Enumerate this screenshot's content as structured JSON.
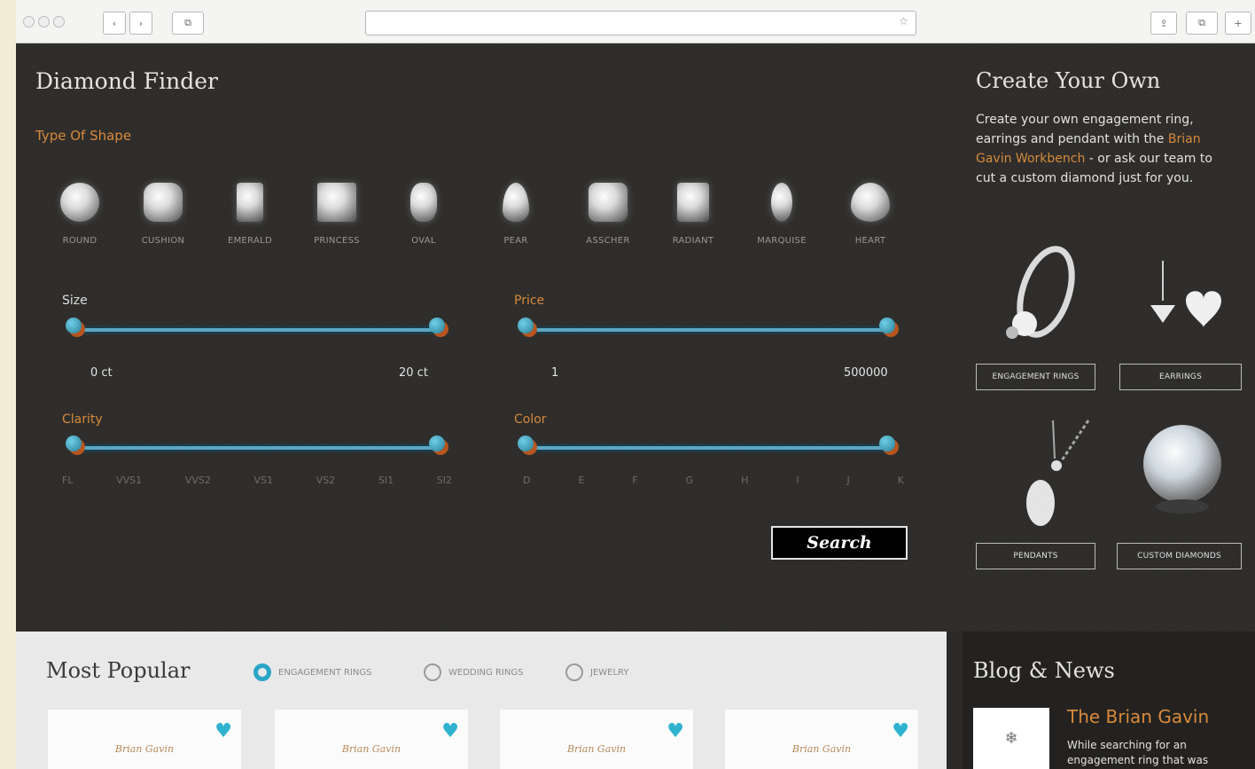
{
  "browser": {
    "nav_buttons": [
      "‹",
      "›",
      "⧉"
    ],
    "right_buttons": [
      "⇪",
      "⧉",
      "+"
    ],
    "url_icon": "star-icon"
  },
  "finder": {
    "title": "Diamond Finder",
    "shape_heading": "Type Of Shape",
    "shapes": [
      "ROUND",
      "CUSHION",
      "EMERALD",
      "PRINCESS",
      "OVAL",
      "PEAR",
      "ASSCHER",
      "RADIANT",
      "MARQUISE",
      "HEART"
    ],
    "size": {
      "label": "Size",
      "min": "0 ct",
      "max": "20 ct",
      "fill": 1.0
    },
    "price": {
      "label": "Price",
      "min": "1",
      "max": "500000",
      "fill": 1.0
    },
    "clarity": {
      "label": "Clarity",
      "ticks": [
        "FL",
        "VVS1",
        "VVS2",
        "VS1",
        "VS2",
        "SI1",
        "SI2"
      ],
      "fill": 1.0
    },
    "color": {
      "label": "Color",
      "ticks": [
        "D",
        "E",
        "F",
        "G",
        "H",
        "I",
        "J",
        "K"
      ],
      "fill": 1.0
    },
    "search_label": "Search"
  },
  "cyo": {
    "title": "Create Your Own",
    "text_before": "Create your own engagement ring, earrings and pendant with the ",
    "link": "Brian Gavin Workbench",
    "text_after": " - or ask our team to cut a custom diamond just for you.",
    "buttons": [
      "ENGAGEMENT RINGS",
      "EARRINGS",
      "PENDANTS",
      "CUSTOM DIAMONDS"
    ]
  },
  "popular": {
    "title": "Most Popular",
    "options": [
      {
        "label": "ENGAGEMENT RINGS",
        "selected": true
      },
      {
        "label": "WEDDING RINGS",
        "selected": false
      },
      {
        "label": "JEWELRY",
        "selected": false
      }
    ],
    "card_logo": "Brian Gavin"
  },
  "blog": {
    "title": "Blog & News",
    "headline": "The Brian Gavin",
    "snippet": "While searching for an engagement ring that was"
  }
}
